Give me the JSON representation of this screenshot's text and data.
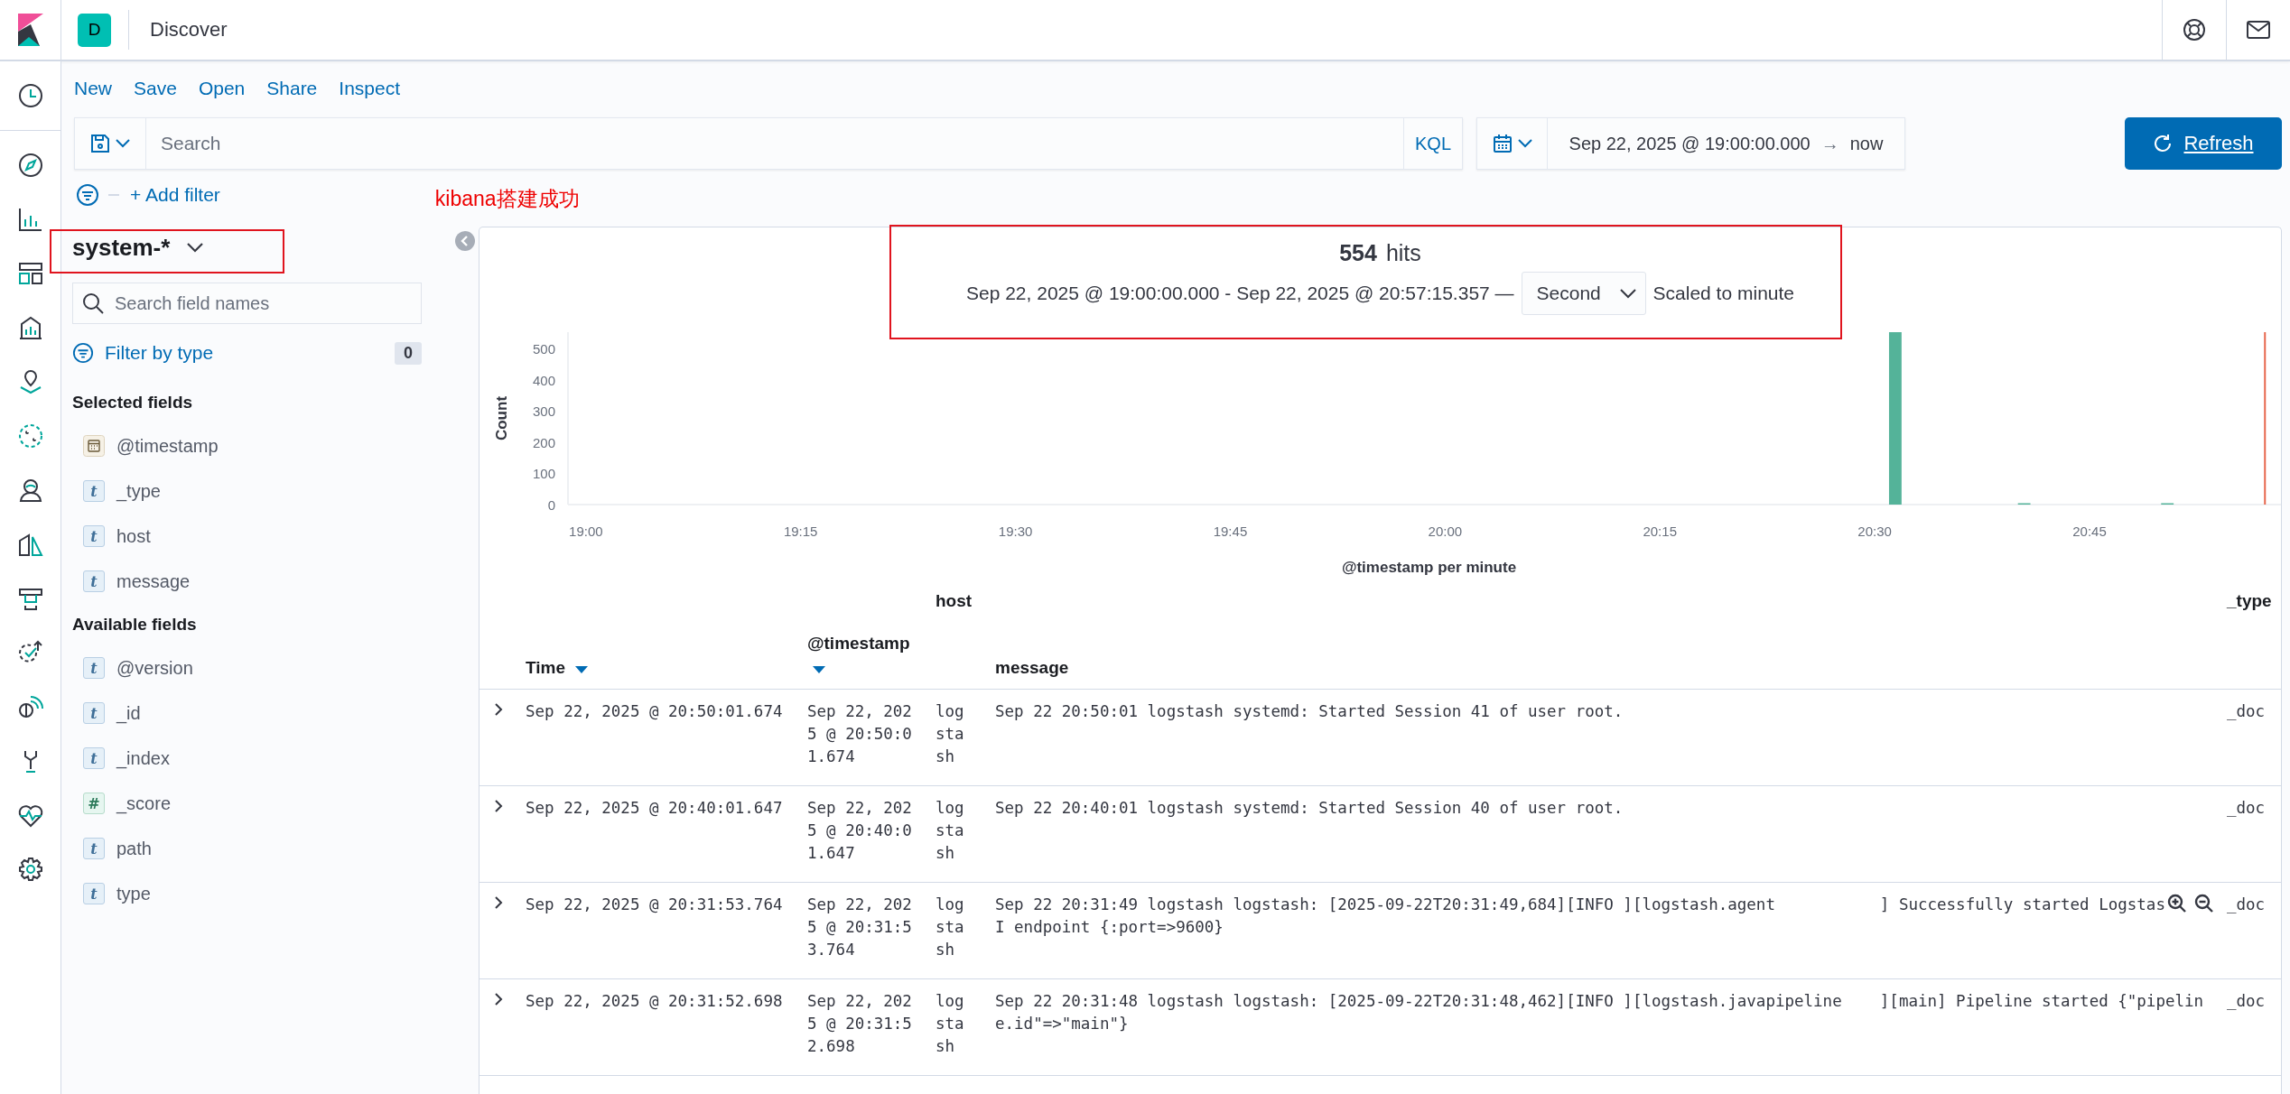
{
  "header": {
    "app_initial": "D",
    "title": "Discover"
  },
  "top_nav": [
    "New",
    "Save",
    "Open",
    "Share",
    "Inspect"
  ],
  "query_bar": {
    "placeholder": "Search",
    "language": "KQL"
  },
  "time_picker": {
    "start": "Sep 22, 2025 @ 19:00:00.000",
    "arrow": "→",
    "end": "now"
  },
  "refresh_button": "Refresh",
  "add_filter": "+ Add filter",
  "annotation": {
    "text": "kibana搭建成功"
  },
  "sidebar": {
    "index_pattern": "system-*",
    "search_placeholder": "Search field names",
    "filter_by_type": "Filter by type",
    "filter_count": "0",
    "groups": [
      {
        "title": "Selected fields",
        "fields": [
          {
            "name": "@timestamp",
            "kind": "date"
          },
          {
            "name": "_type",
            "kind": "string",
            "glyph": "t"
          },
          {
            "name": "host",
            "kind": "string",
            "glyph": "t"
          },
          {
            "name": "message",
            "kind": "string",
            "glyph": "t"
          }
        ]
      },
      {
        "title": "Available fields",
        "fields": [
          {
            "name": "@version",
            "kind": "string",
            "glyph": "t"
          },
          {
            "name": "_id",
            "kind": "string",
            "glyph": "t"
          },
          {
            "name": "_index",
            "kind": "string",
            "glyph": "t"
          },
          {
            "name": "_score",
            "kind": "number",
            "glyph": "#"
          },
          {
            "name": "path",
            "kind": "string",
            "glyph": "t"
          },
          {
            "name": "type",
            "kind": "string",
            "glyph": "t"
          }
        ]
      }
    ]
  },
  "hits": {
    "count": "554",
    "label": "hits",
    "range": "Sep 22, 2025 @ 19:00:00.000 - Sep 22, 2025 @ 20:57:15.357 —",
    "interval": "Second",
    "scaled_note": "Scaled to minute"
  },
  "chart": {
    "now_line": true,
    "chart_data": {
      "type": "bar",
      "xlabel": "@timestamp per minute",
      "ylabel": "Count",
      "categories": [
        "19:00",
        null,
        null,
        null,
        null,
        null,
        null,
        null,
        null,
        null,
        null,
        null,
        null,
        null,
        null,
        "19:15",
        null,
        null,
        null,
        null,
        null,
        null,
        null,
        null,
        null,
        null,
        null,
        null,
        null,
        null,
        "19:30",
        null,
        null,
        null,
        null,
        null,
        null,
        null,
        null,
        null,
        null,
        null,
        null,
        null,
        null,
        "19:45",
        null,
        null,
        null,
        null,
        null,
        null,
        null,
        null,
        null,
        null,
        null,
        null,
        null,
        null,
        "20:00",
        null,
        null,
        null,
        null,
        null,
        null,
        null,
        null,
        null,
        null,
        null,
        null,
        null,
        null,
        "20:15",
        null,
        null,
        null,
        null,
        null,
        null,
        null,
        null,
        null,
        null,
        null,
        null,
        null,
        null,
        "20:30",
        null,
        null,
        null,
        null,
        null,
        null,
        null,
        null,
        null,
        null,
        null,
        null,
        null,
        null,
        "20:45",
        null,
        null,
        null,
        null,
        null,
        null,
        null,
        null,
        null,
        null,
        null,
        null,
        null
      ],
      "series": [
        {
          "color": "#54b399",
          "values": [
            0,
            0,
            0,
            0,
            0,
            0,
            0,
            0,
            0,
            0,
            0,
            0,
            0,
            0,
            0,
            0,
            0,
            0,
            0,
            0,
            0,
            0,
            0,
            0,
            0,
            0,
            0,
            0,
            0,
            0,
            0,
            0,
            0,
            0,
            0,
            0,
            0,
            0,
            0,
            0,
            0,
            0,
            0,
            0,
            0,
            0,
            0,
            0,
            0,
            0,
            0,
            0,
            0,
            0,
            0,
            0,
            0,
            0,
            0,
            0,
            0,
            0,
            0,
            0,
            0,
            0,
            0,
            0,
            0,
            0,
            0,
            0,
            0,
            0,
            0,
            0,
            0,
            0,
            0,
            0,
            0,
            0,
            0,
            0,
            0,
            0,
            0,
            0,
            0,
            0,
            0,
            552,
            0,
            0,
            0,
            0,
            0,
            0,
            0,
            0,
            1,
            0,
            0,
            0,
            0,
            0,
            0,
            0,
            0,
            0,
            1,
            0,
            0,
            0,
            0,
            0,
            0,
            0,
            0
          ]
        }
      ],
      "ylim": [
        0,
        552
      ],
      "yticks": [
        0,
        100,
        200,
        300,
        400,
        500
      ]
    }
  },
  "table": {
    "columns": [
      {
        "label": "Time",
        "sorted": true
      },
      {
        "label": "@timestamp",
        "sorted": true
      },
      {
        "label": "host",
        "sorted": false
      },
      {
        "label": "message",
        "sorted": false
      },
      {
        "label": "_type",
        "sorted": false
      }
    ],
    "rows": [
      {
        "time": "Sep 22, 2025 @ 20:50:01.674",
        "timestamp": "Sep 22, 2025 @ 20:50:01.674",
        "host": "logstash",
        "message": [
          "Sep 22 20:50:01 logstash systemd: Started Session 41 of user root."
        ],
        "type": "_doc",
        "filter_icons": false
      },
      {
        "time": "Sep 22, 2025 @ 20:40:01.647",
        "timestamp": "Sep 22, 2025 @ 20:40:01.647",
        "host": "logstash",
        "message": [
          "Sep 22 20:40:01 logstash systemd: Started Session 40 of user root."
        ],
        "type": "_doc",
        "filter_icons": false
      },
      {
        "time": "Sep 22, 2025 @ 20:31:53.764",
        "timestamp": "Sep 22, 2025 @ 20:31:53.764",
        "host": "logstash",
        "message": [
          "Sep 22 20:31:49 logstash logstash: [2025-09-22T20:31:49,684][INFO ][logstash.agent           ] Successfully started Logstas",
          "I endpoint {:port=>9600}"
        ],
        "type": "_doc",
        "filter_icons": true
      },
      {
        "time": "Sep 22, 2025 @ 20:31:52.698",
        "timestamp": "Sep 22, 2025 @ 20:31:52.698",
        "host": "logstash",
        "message": [
          "Sep 22 20:31:48 logstash logstash: [2025-09-22T20:31:48,462][INFO ][logstash.javapipeline    ][main] Pipeline started {\"pipelin",
          "e.id\"=>\"main\"}"
        ],
        "type": "_doc",
        "filter_icons": false
      }
    ]
  }
}
